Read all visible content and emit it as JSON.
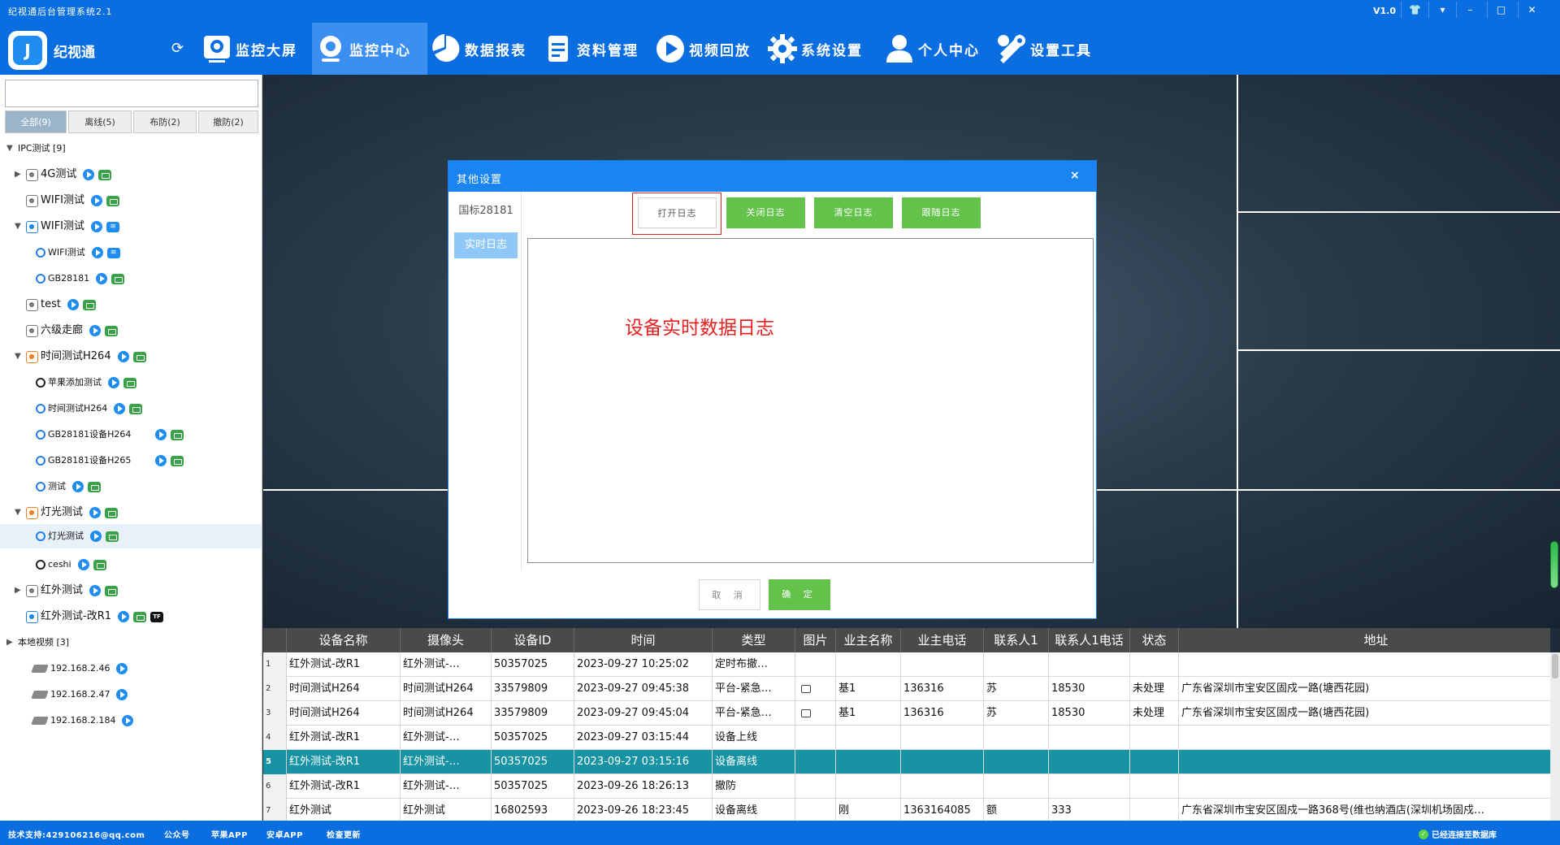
{
  "window": {
    "title": "纪视通后台管理系统2.1",
    "version": "V1.0"
  },
  "brand": {
    "name": "纪视通",
    "logo_glyph": "J"
  },
  "nav": [
    {
      "label": "监控大屏",
      "icon": "monitor-icon"
    },
    {
      "label": "监控中心",
      "icon": "camera-icon",
      "active": true
    },
    {
      "label": "数据报表",
      "icon": "pie-chart-icon"
    },
    {
      "label": "资料管理",
      "icon": "document-icon"
    },
    {
      "label": "视频回放",
      "icon": "play-icon"
    },
    {
      "label": "系统设置",
      "icon": "gear-icon"
    },
    {
      "label": "个人中心",
      "icon": "user-icon"
    },
    {
      "label": "设置工具",
      "icon": "tools-icon"
    }
  ],
  "sidebar": {
    "search_value": "",
    "filters": [
      "全部(9)",
      "离线(5)",
      "布防(2)",
      "撤防(2)"
    ],
    "tree": [
      {
        "label": "IPC测试 [9]",
        "level": 0
      },
      {
        "label": "4G测试",
        "level": 1
      },
      {
        "label": "WIFI测试",
        "level": 1
      },
      {
        "label": "WIFI测试",
        "level": 1
      },
      {
        "label": "WIFI测试",
        "level": 2
      },
      {
        "label": "GB28181",
        "level": 2
      },
      {
        "label": "test",
        "level": 1
      },
      {
        "label": "六级走廊",
        "level": 1
      },
      {
        "label": "时间测试H264",
        "level": 1
      },
      {
        "label": "苹果添加测试",
        "level": 2
      },
      {
        "label": "时间测试H264",
        "level": 2
      },
      {
        "label": "GB28181设备H264",
        "level": 2
      },
      {
        "label": "GB28181设备H265",
        "level": 2
      },
      {
        "label": "测试",
        "level": 2
      },
      {
        "label": "灯光测试",
        "level": 1
      },
      {
        "label": "灯光测试",
        "level": 2
      },
      {
        "label": "ceshi",
        "level": 2
      },
      {
        "label": "红外测试",
        "level": 1
      },
      {
        "label": "红外测试-改R1",
        "level": 1
      },
      {
        "label": "本地视频 [3]",
        "level": 0
      },
      {
        "label": "192.168.2.46",
        "level": 1
      },
      {
        "label": "192.168.2.47",
        "level": 1
      },
      {
        "label": "192.168.2.184",
        "level": 1
      }
    ]
  },
  "dialog": {
    "title": "其他设置",
    "close_glyph": "×",
    "side_tabs": [
      "国标28181",
      "实时日志"
    ],
    "log_buttons": [
      "打开日志",
      "关闭日志",
      "清空日志",
      "跟随日志"
    ],
    "caption": "设备实时数据日志",
    "cancel": "取 消",
    "ok": "确 定"
  },
  "table": {
    "columns": [
      "设备名称",
      "摄像头",
      "设备ID",
      "时间",
      "类型",
      "图片",
      "业主名称",
      "业主电话",
      "联系人1",
      "联系人1电话",
      "状态",
      "地址"
    ],
    "rows": [
      {
        "n": "1",
        "cells": [
          "红外测试-改R1",
          "红外测试-…",
          "50357025",
          "2023-09-27  10:25:02",
          "定时布撤…",
          "",
          "",
          "",
          "",
          "",
          "",
          ""
        ]
      },
      {
        "n": "2",
        "cells": [
          "时间测试H264",
          "时间测试H264",
          "33579809",
          "2023-09-27  09:45:38",
          "平台-紧急…",
          "img",
          "基1",
          "136316",
          "苏",
          "18530",
          "未处理",
          "广东省深圳市宝安区固戍一路(塘西花园)"
        ]
      },
      {
        "n": "3",
        "cells": [
          "时间测试H264",
          "时间测试H264",
          "33579809",
          "2023-09-27  09:45:04",
          "平台-紧急…",
          "img",
          "基1",
          "136316",
          "苏",
          "18530",
          "未处理",
          "广东省深圳市宝安区固戍一路(塘西花园)"
        ]
      },
      {
        "n": "4",
        "cells": [
          "红外测试-改R1",
          "红外测试-…",
          "50357025",
          "2023-09-27  03:15:44",
          "设备上线",
          "",
          "",
          "",
          "",
          "",
          "",
          ""
        ]
      },
      {
        "n": "5",
        "cells": [
          "红外测试-改R1",
          "红外测试-…",
          "50357025",
          "2023-09-27  03:15:16",
          "设备离线",
          "",
          "",
          "",
          "",
          "",
          "",
          ""
        ],
        "selected": true
      },
      {
        "n": "6",
        "cells": [
          "红外测试-改R1",
          "红外测试-…",
          "50357025",
          "2023-09-26  18:26:13",
          "撤防",
          "",
          "",
          "",
          "",
          "",
          "",
          ""
        ]
      },
      {
        "n": "7",
        "cells": [
          "红外测试",
          "红外测试",
          "16802593",
          "2023-09-26  18:23:45",
          "设备离线",
          "",
          "刚",
          "1363164085",
          "额",
          "333",
          "",
          "广东省深圳市宝安区固戍一路368号(维也纳酒店(深圳机场固戍…"
        ]
      }
    ]
  },
  "statusbar": {
    "support": "技术支持:429106216@qq.com",
    "wechat": "公众号",
    "apple": "苹果APP",
    "android": "安卓APP",
    "update": "检查更新",
    "connection": "已经连接至数据库"
  },
  "colors": {
    "primary": "#0a6ee0",
    "green": "#63c24a",
    "selected_row": "#1793a3",
    "caption_red": "#ea1f1f"
  }
}
